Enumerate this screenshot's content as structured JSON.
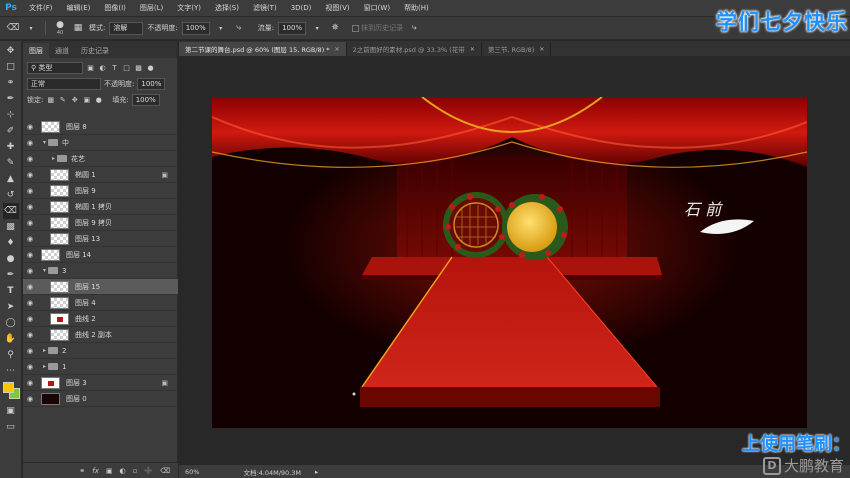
{
  "app": {
    "logo": "Ps"
  },
  "menu": [
    "文件(F)",
    "编辑(E)",
    "图像(I)",
    "图层(L)",
    "文字(Y)",
    "选择(S)",
    "滤镜(T)",
    "3D(D)",
    "视图(V)",
    "窗口(W)",
    "帮助(H)"
  ],
  "options": {
    "brush_size": "40",
    "mode_label": "模式:",
    "mode_value": "溶解",
    "opacity_label": "不透明度:",
    "opacity_value": "100%",
    "flow_label": "流量:",
    "flow_value": "100%",
    "history_label": "抹到历史记录"
  },
  "overlay": {
    "title": "学们七夕快乐",
    "subtitle": "上使用笔刷：",
    "watermark": "大鹏教育"
  },
  "panel": {
    "tabs": [
      "图层",
      "通道",
      "历史记录"
    ],
    "filter_kind": "类型",
    "blend_mode": "正常",
    "opacity_label": "不透明度:",
    "opacity_value": "100%",
    "lock_label": "锁定:",
    "fill_label": "填充:",
    "fill_value": "100%"
  },
  "layers": [
    {
      "name": "图层 8",
      "type": "layer",
      "indent": 0,
      "thumb": "checker",
      "locked": false,
      "selected": false
    },
    {
      "name": "中",
      "type": "group",
      "indent": 0,
      "open": true
    },
    {
      "name": "花艺",
      "type": "group",
      "indent": 1,
      "open": false
    },
    {
      "name": "椭圆 1",
      "type": "layer",
      "indent": 1,
      "thumb": "checker",
      "locked": true,
      "selected": false
    },
    {
      "name": "图层 9",
      "type": "layer",
      "indent": 1,
      "thumb": "checker",
      "locked": false,
      "selected": false
    },
    {
      "name": "椭圆 1 拷贝",
      "type": "layer",
      "indent": 1,
      "thumb": "checker",
      "locked": false,
      "selected": false
    },
    {
      "name": "图层 9 拷贝",
      "type": "layer",
      "indent": 1,
      "thumb": "checker",
      "locked": false,
      "selected": false
    },
    {
      "name": "图层 13",
      "type": "layer",
      "indent": 1,
      "thumb": "checker",
      "locked": false,
      "selected": false
    },
    {
      "name": "图层 14",
      "type": "layer",
      "indent": 0,
      "thumb": "checker",
      "locked": false,
      "selected": false
    },
    {
      "name": "3",
      "type": "group",
      "indent": 0,
      "open": true
    },
    {
      "name": "图层 15",
      "type": "layer",
      "indent": 1,
      "thumb": "checker",
      "locked": false,
      "selected": true
    },
    {
      "name": "图层 4",
      "type": "layer",
      "indent": 1,
      "thumb": "checker",
      "locked": false,
      "selected": false
    },
    {
      "name": "曲线 2",
      "type": "layer",
      "indent": 1,
      "thumb": "red",
      "locked": false,
      "selected": false
    },
    {
      "name": "曲线 2 副本",
      "type": "layer",
      "indent": 1,
      "thumb": "checker",
      "locked": false,
      "selected": false
    },
    {
      "name": "2",
      "type": "group",
      "indent": 0,
      "open": false
    },
    {
      "name": "1",
      "type": "group",
      "indent": 0,
      "open": false
    },
    {
      "name": "图层 3",
      "type": "layer",
      "indent": 0,
      "thumb": "red",
      "locked": true,
      "selected": false
    },
    {
      "name": "图层 0",
      "type": "layer",
      "indent": 0,
      "thumb": "dark",
      "locked": false,
      "selected": false
    }
  ],
  "doc_tabs": [
    {
      "label": "第二节课的舞台.psd @ 60% (图层 15, RGB/8) *",
      "active": true
    },
    {
      "label": "2之前图好的素材.psd @ 33.3% (花带",
      "active": false
    },
    {
      "label": "第三节, RGB/8)",
      "active": false
    }
  ],
  "canvas": {
    "handwriting": "石 前"
  },
  "status": {
    "zoom": "60%",
    "doc_info": "文档:4.04M/90.3M"
  },
  "colors": {
    "foreground": "#f7c600",
    "background": "#7cc83d",
    "accent": "#1e90ff"
  }
}
